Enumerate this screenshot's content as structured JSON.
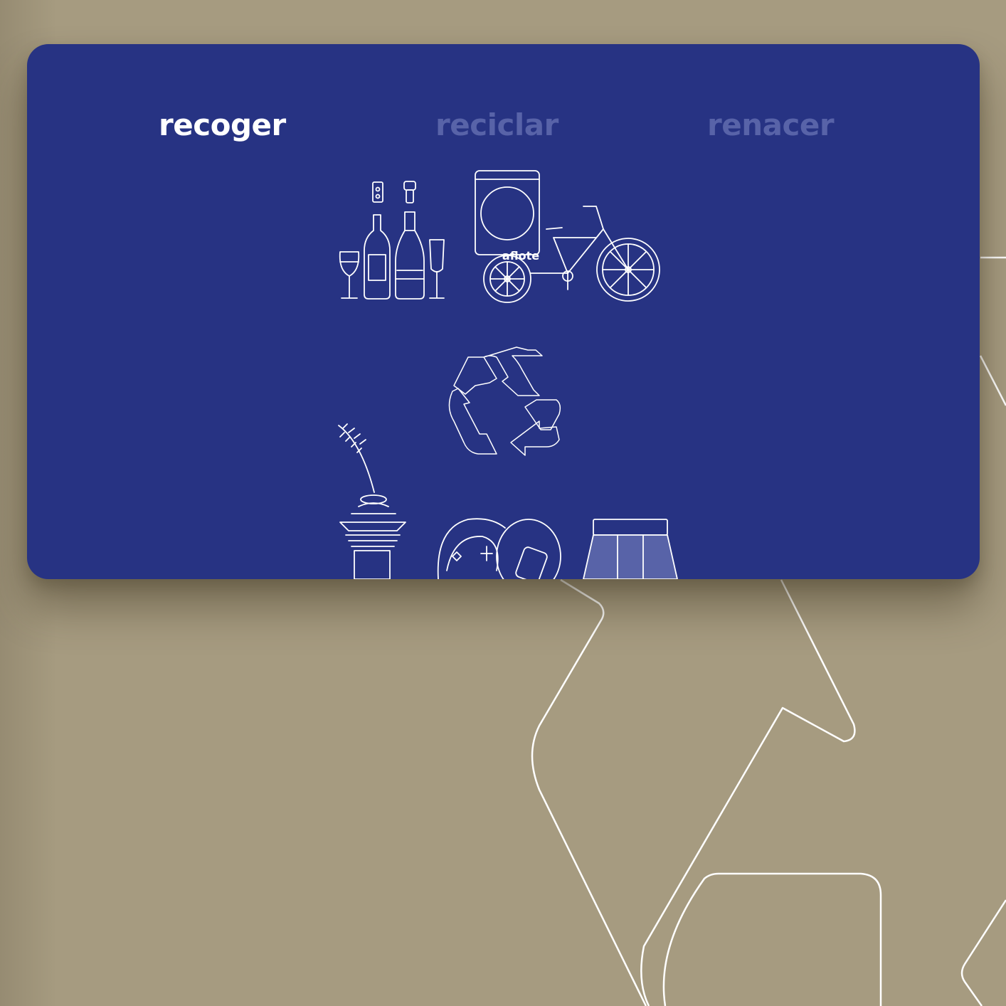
{
  "tabs": [
    {
      "label": "recoger",
      "active": true
    },
    {
      "label": "reciclar",
      "active": false
    },
    {
      "label": "renacer",
      "active": false
    }
  ],
  "illustration": {
    "bin_brand": "aflote",
    "icons": [
      "wine-glass-icon",
      "wine-bottle-icon",
      "champagne-bottle-icon",
      "champagne-flute-icon",
      "cork-icon",
      "cargo-bike-icon",
      "recycle-icon",
      "plant-vase-icon",
      "plate-icon",
      "stool-icon"
    ]
  },
  "colors": {
    "background": "#a69b80",
    "card": "#273383",
    "tab_active": "#ffffff",
    "tab_inactive": "#5863a8",
    "line_art": "#ffffff"
  }
}
